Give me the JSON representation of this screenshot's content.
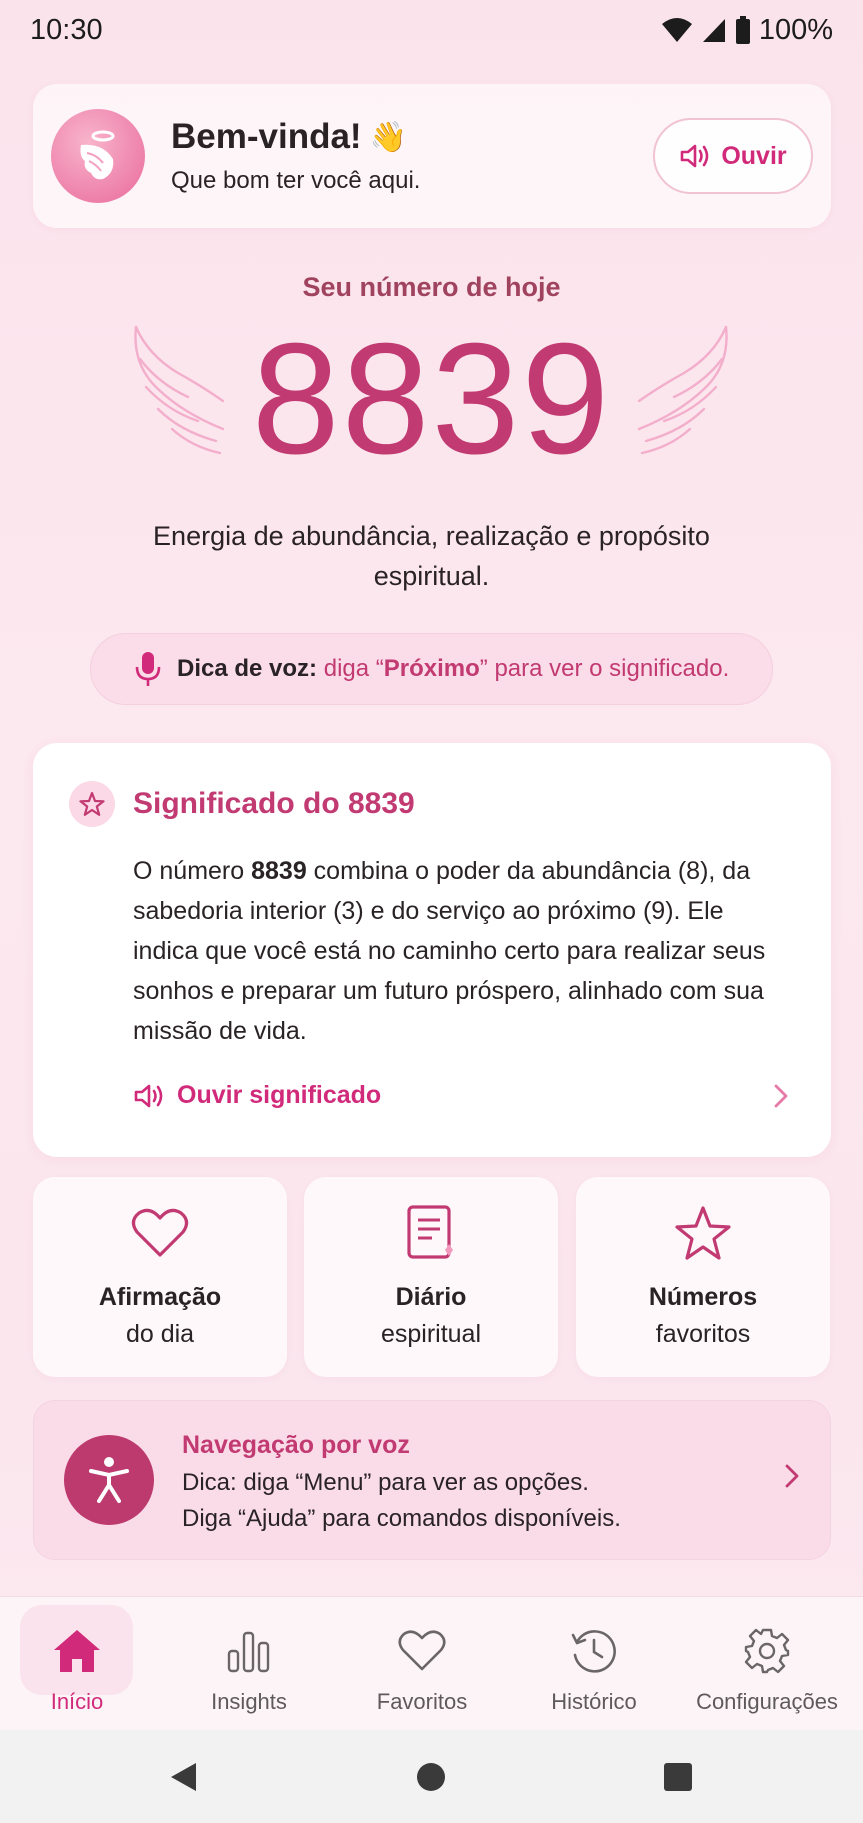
{
  "status_bar": {
    "time": "10:30",
    "battery": "100%"
  },
  "welcome": {
    "title": "Bem-vinda!",
    "wave_emoji": "👋",
    "subtitle": "Que bom ter você aqui.",
    "listen_label": "Ouvir"
  },
  "today": {
    "label": "Seu número de hoje",
    "number": "8839",
    "description": "Energia de abundância, realização e propósito espiritual."
  },
  "voice_tip": {
    "prefix": "Dica de voz:",
    "say": "diga “",
    "command": "Próximo",
    "suffix": "” para ver o significado."
  },
  "meaning": {
    "title": "Significado do 8839",
    "body_pre": "O número ",
    "body_number": "8839",
    "body_post": " combina o poder da abundância (8), da sabedoria interior (3) e do serviço ao próximo (9). Ele indica que você está no caminho certo para realizar seus sonhos e preparar um futuro próspero, alinhado com sua missão de vida.",
    "listen_label": "Ouvir significado"
  },
  "quick_actions": [
    {
      "title": "Afirmação",
      "subtitle": "do dia",
      "icon": "heart-icon"
    },
    {
      "title": "Diário",
      "subtitle": "espiritual",
      "icon": "journal-icon"
    },
    {
      "title": "Números",
      "subtitle": "favoritos",
      "icon": "star-icon"
    }
  ],
  "voice_nav": {
    "title": "Navegação por voz",
    "line1": "Dica: diga “Menu” para ver as opções.",
    "line2": "Diga “Ajuda” para comandos disponíveis."
  },
  "bottom_nav": {
    "items": [
      {
        "label": "Início",
        "icon": "home-icon"
      },
      {
        "label": "Insights",
        "icon": "chart-icon"
      },
      {
        "label": "Favoritos",
        "icon": "heart-icon"
      },
      {
        "label": "Histórico",
        "icon": "history-icon"
      },
      {
        "label": "Configurações",
        "icon": "gear-icon"
      }
    ],
    "active_index": 0
  },
  "colors": {
    "accent": "#d12a7a",
    "accent_dark": "#c23a72",
    "background": "#fbe3ec"
  }
}
